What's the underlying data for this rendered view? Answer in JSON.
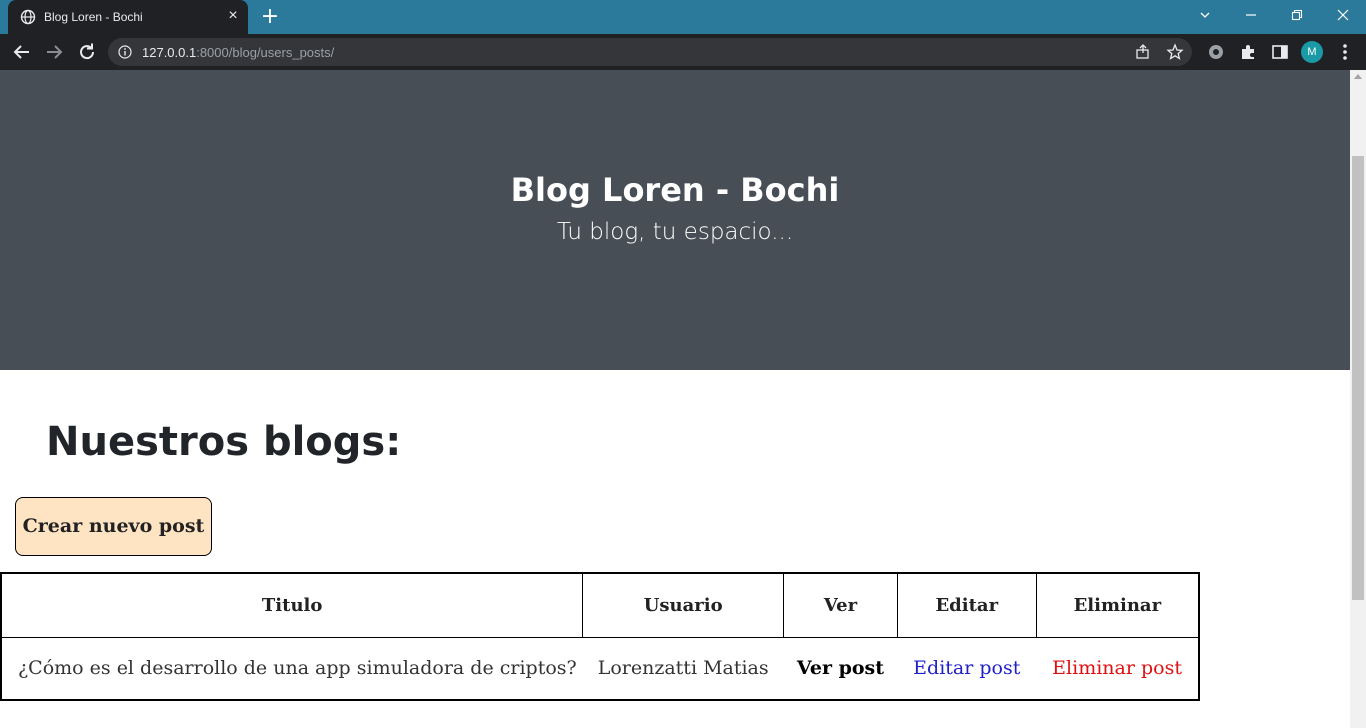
{
  "browser": {
    "tab_title": "Blog Loren - Bochi",
    "url_host": "127.0.0.1",
    "url_rest": ":8000/blog/users_posts/",
    "profile_initial": "M"
  },
  "site": {
    "title": "Blog Loren - Bochi",
    "subtitle": "Tu blog, tu espacio..."
  },
  "main": {
    "heading": "Nuestros blogs:",
    "create_button": "Crear nuevo post"
  },
  "table": {
    "headers": [
      "Titulo",
      "Usuario",
      "Ver",
      "Editar",
      "Eliminar"
    ],
    "rows": [
      {
        "title": "¿Cómo es el desarrollo de una app simuladora de criptos?",
        "user": "Lorenzatti Matias",
        "view": "Ver post",
        "edit": "Editar post",
        "delete": "Eliminar post"
      }
    ]
  },
  "colors": {
    "tabbar": "#2b7a9b",
    "hero": "#484e56",
    "create_button": "#ffe4c4",
    "edit_link": "#2020c8",
    "delete_link": "#e01010"
  }
}
